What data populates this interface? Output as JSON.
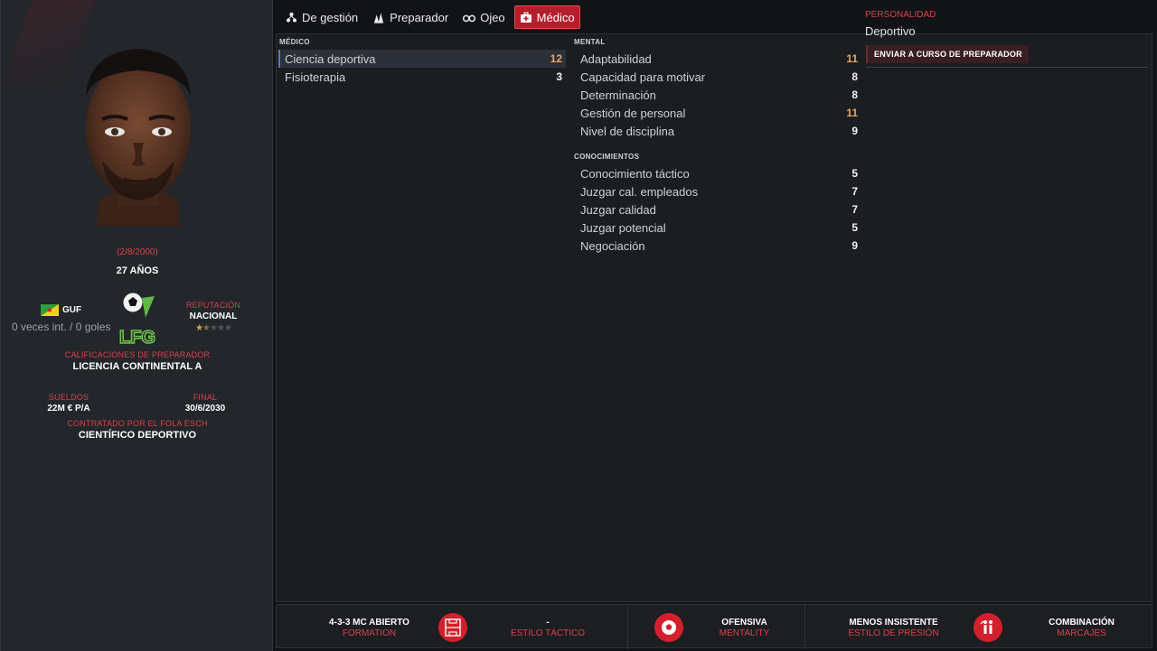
{
  "profile": {
    "dob": "(2/8/2000)",
    "age": "27 AÑOS",
    "nation_code": "GUF",
    "caps": "0 veces int. / 0 goles",
    "reputation_label": "REPUTACIÓN",
    "reputation_value": "NACIONAL",
    "reputation_stars": 1.5,
    "coach_qual_label": "CALIFICACIONES DE PREPARADOR",
    "coach_qual_value": "LICENCIA CONTINENTAL A",
    "wage_label": "SUELDOS",
    "wage_value": "22M € P/A",
    "final_label": "FINAL",
    "final_value": "30/6/2030",
    "hired_label": "CONTRATADO POR EL FOLA ESCH",
    "hired_value": "CIENTÍFICO DEPORTIVO"
  },
  "tabs": [
    {
      "label": "De gestión",
      "icon": "management-icon",
      "active": false
    },
    {
      "label": "Preparador",
      "icon": "coach-icon",
      "active": false
    },
    {
      "label": "Ojeo",
      "icon": "binoculars-icon",
      "active": false
    },
    {
      "label": "Médico",
      "icon": "medical-kit-icon",
      "active": true
    }
  ],
  "medical": {
    "title": "MÉDICO",
    "rows": [
      {
        "label": "Ciencia deportiva",
        "value": "12"
      },
      {
        "label": "Fisioterapia",
        "value": "3"
      }
    ]
  },
  "mental": {
    "title": "MENTAL",
    "rows": [
      {
        "label": "Adaptabilidad",
        "value": "11"
      },
      {
        "label": "Capacidad para motivar",
        "value": "8"
      },
      {
        "label": "Determinación",
        "value": "8"
      },
      {
        "label": "Gestión de personal",
        "value": "11"
      },
      {
        "label": "Nivel de disciplina",
        "value": "9"
      }
    ]
  },
  "knowledge": {
    "title": "CONOCIMIENTOS",
    "rows": [
      {
        "label": "Conocimiento táctico",
        "value": "5"
      },
      {
        "label": "Juzgar cal. empleados",
        "value": "7"
      },
      {
        "label": "Juzgar calidad",
        "value": "7"
      },
      {
        "label": "Juzgar potencial",
        "value": "5"
      },
      {
        "label": "Negociación",
        "value": "9"
      }
    ]
  },
  "personality": {
    "label": "PERSONALIDAD",
    "value": "Deportivo",
    "button": "ENVIAR A CURSO DE PREPARADOR"
  },
  "bottom": {
    "formation_value": "4-3-3 MC ABIERTO",
    "formation_label": "FORMATION",
    "style_value": "-",
    "style_label": "ESTILO TÁCTICO",
    "mentality_value": "OFENSIVA",
    "mentality_label": "MENTALITY",
    "press_value": "MENOS INSISTENTE",
    "press_label": "ESTILO DE PRESIÓN",
    "marking_value": "COMBINACIÓN",
    "marking_label": "MARCAJES"
  },
  "colors": {
    "accent": "#d4202c",
    "highlight": "#e8a865"
  }
}
